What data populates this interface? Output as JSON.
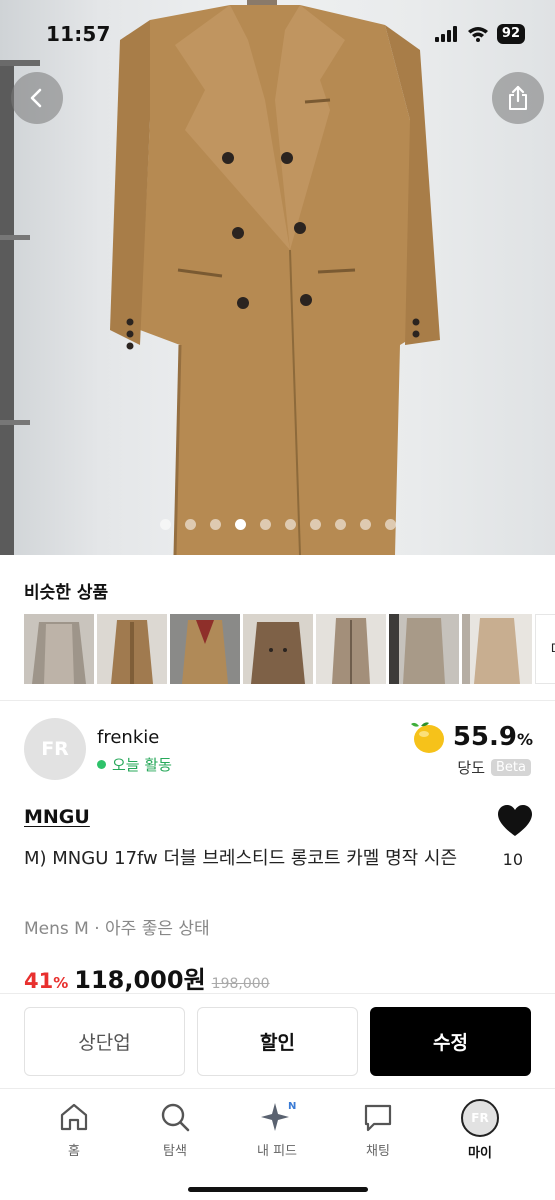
{
  "status_bar": {
    "time": "11:57",
    "battery": "92"
  },
  "hero": {
    "back_icon": "chevron-left-icon",
    "share_icon": "share-icon",
    "image_count": 10,
    "active_image": 4
  },
  "similar": {
    "title": "비슷한 상품",
    "more_label": "더보기",
    "thumbnails": [
      {
        "color": "#b9b3ab"
      },
      {
        "color": "#a07a4f"
      },
      {
        "color": "#b08a58"
      },
      {
        "color": "#7e6147"
      },
      {
        "color": "#8a6a4f"
      },
      {
        "color": "#a89a88"
      },
      {
        "color": "#c8ae90"
      }
    ]
  },
  "seller": {
    "avatar_initials": "FR",
    "name": "frenkie",
    "status": "오늘 활동",
    "sweetness_value": "55.9",
    "sweetness_unit": "%",
    "sweetness_label": "당도",
    "beta_badge": "Beta"
  },
  "product": {
    "brand": "MNGU",
    "title": "M) MNGU 17fw 더블 브레스티드 롱코트 카멜 명작 시즌",
    "condition": "Mens M · 아주 좋은 상태",
    "discount_value": "41",
    "discount_unit": "%",
    "price": "118,000원",
    "original_price": "198,000",
    "like_count": "10"
  },
  "actions": {
    "bump_label": "상단업",
    "discount_label": "할인",
    "edit_label": "수정"
  },
  "tabs": [
    {
      "label": "홈",
      "icon": "home-icon"
    },
    {
      "label": "탐색",
      "icon": "search-icon"
    },
    {
      "label": "내 피드",
      "icon": "sparkle-icon",
      "badge": "N"
    },
    {
      "label": "채팅",
      "icon": "chat-icon"
    },
    {
      "label": "마이",
      "icon": "avatar",
      "initials": "FR"
    }
  ],
  "colors": {
    "accent_red": "#e8302e",
    "online_green": "#2ec26a",
    "coat_camel": "#b68a52"
  }
}
